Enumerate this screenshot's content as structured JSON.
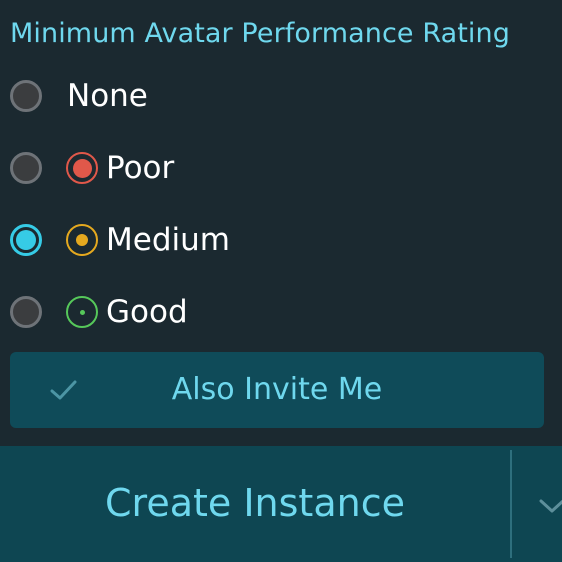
{
  "section": {
    "title": "Minimum Avatar Performance Rating"
  },
  "options": [
    {
      "label": "None",
      "selected": false,
      "icon": null
    },
    {
      "label": "Poor",
      "selected": false,
      "icon": "poor-rating-icon",
      "icon_color": "#e0584a"
    },
    {
      "label": "Medium",
      "selected": true,
      "icon": "medium-rating-icon",
      "icon_color": "#e5a91f"
    },
    {
      "label": "Good",
      "selected": false,
      "icon": "good-rating-icon",
      "icon_color": "#56c85a"
    }
  ],
  "invite": {
    "label": "Also Invite Me",
    "icon": "check-icon"
  },
  "create": {
    "label": "Create Instance",
    "dropdown_icon": "chevron-down-icon"
  },
  "colors": {
    "background": "#1b2930",
    "accent": "#36cbe6",
    "accent_text": "#6fd8ee",
    "button_bg": "#0e4652"
  }
}
